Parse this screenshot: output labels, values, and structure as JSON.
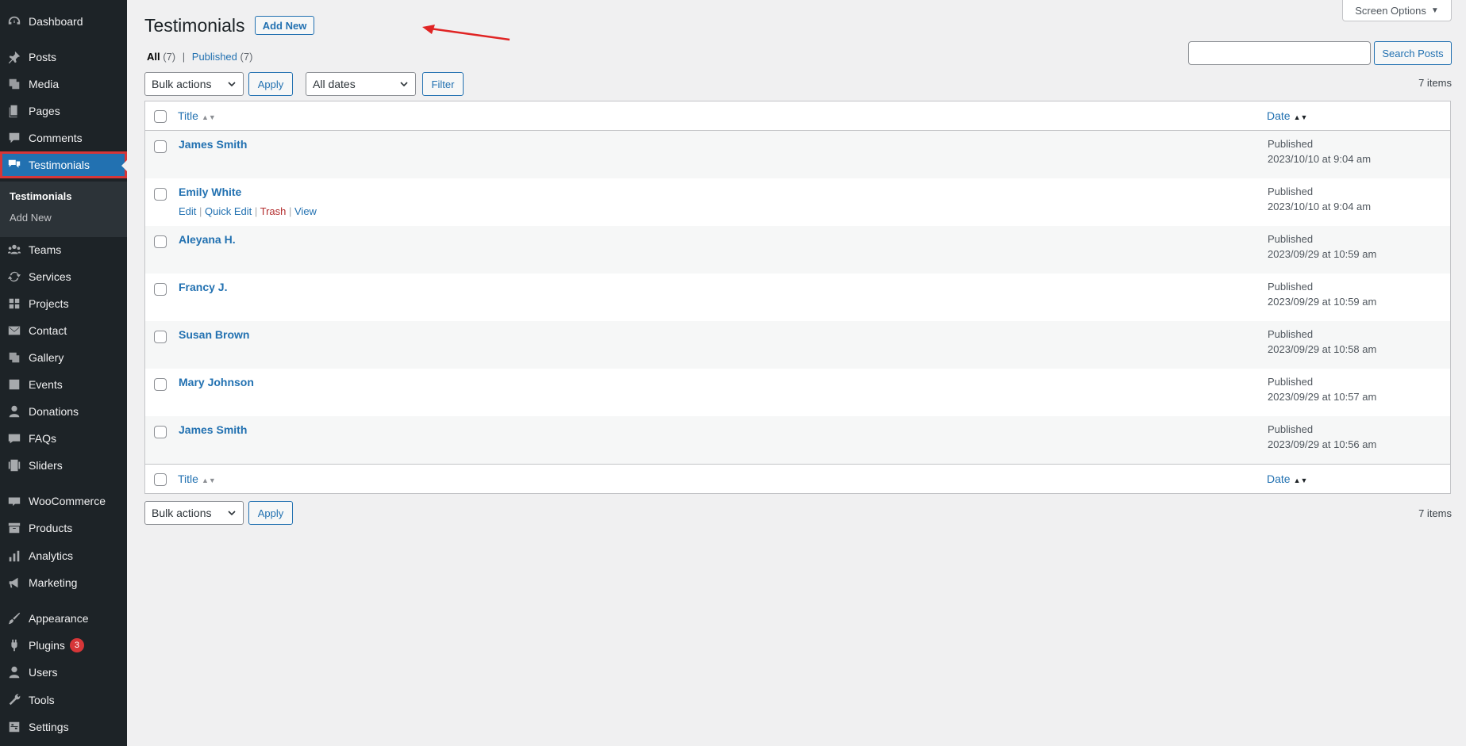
{
  "sidebar": {
    "items": [
      {
        "label": "Dashboard",
        "icon": "dashboard-icon"
      },
      {
        "label": "Posts",
        "icon": "pin-icon"
      },
      {
        "label": "Media",
        "icon": "media-icon"
      },
      {
        "label": "Pages",
        "icon": "pages-icon"
      },
      {
        "label": "Comments",
        "icon": "comment-icon"
      },
      {
        "label": "Testimonials",
        "icon": "testimonial-icon"
      },
      {
        "label": "Teams",
        "icon": "groups-icon"
      },
      {
        "label": "Services",
        "icon": "update-icon"
      },
      {
        "label": "Projects",
        "icon": "grid-icon"
      },
      {
        "label": "Contact",
        "icon": "email-icon"
      },
      {
        "label": "Gallery",
        "icon": "gallery-icon"
      },
      {
        "label": "Events",
        "icon": "calendar-icon"
      },
      {
        "label": "Donations",
        "icon": "person-icon"
      },
      {
        "label": "FAQs",
        "icon": "chat-icon"
      },
      {
        "label": "Sliders",
        "icon": "slides-icon"
      },
      {
        "label": "WooCommerce",
        "icon": "woo-icon"
      },
      {
        "label": "Products",
        "icon": "archive-icon"
      },
      {
        "label": "Analytics",
        "icon": "chart-bar-icon"
      },
      {
        "label": "Marketing",
        "icon": "megaphone-icon"
      },
      {
        "label": "Appearance",
        "icon": "brush-icon"
      },
      {
        "label": "Plugins",
        "icon": "plug-icon",
        "badge": "3"
      },
      {
        "label": "Users",
        "icon": "user-icon"
      },
      {
        "label": "Tools",
        "icon": "wrench-icon"
      },
      {
        "label": "Settings",
        "icon": "settings-icon"
      }
    ],
    "submenu": [
      "Testimonials",
      "Add New"
    ]
  },
  "header": {
    "title": "Testimonials",
    "add_new": "Add New",
    "screen_options": "Screen Options"
  },
  "views": {
    "all_label": "All",
    "all_count": "(7)",
    "sep": "|",
    "published_label": "Published",
    "published_count": "(7)"
  },
  "search": {
    "button": "Search Posts",
    "value": ""
  },
  "toolbar": {
    "bulk_actions": "Bulk actions",
    "apply": "Apply",
    "all_dates": "All dates",
    "filter": "Filter",
    "items_count": "7 items"
  },
  "table": {
    "col_title": "Title",
    "col_date": "Date",
    "row_actions": {
      "edit": "Edit",
      "quick_edit": "Quick Edit",
      "trash": "Trash",
      "view": "View"
    },
    "rows": [
      {
        "name": "James Smith",
        "status": "Published",
        "date": "2023/10/10 at 9:04 am"
      },
      {
        "name": "Emily White",
        "status": "Published",
        "date": "2023/10/10 at 9:04 am"
      },
      {
        "name": "Aleyana H.",
        "status": "Published",
        "date": "2023/09/29 at 10:59 am"
      },
      {
        "name": "Francy J.",
        "status": "Published",
        "date": "2023/09/29 at 10:59 am"
      },
      {
        "name": "Susan Brown",
        "status": "Published",
        "date": "2023/09/29 at 10:58 am"
      },
      {
        "name": "Mary Johnson",
        "status": "Published",
        "date": "2023/09/29 at 10:57 am"
      },
      {
        "name": "James Smith",
        "status": "Published",
        "date": "2023/09/29 at 10:56 am"
      }
    ]
  },
  "colors": {
    "sidebar_bg": "#1d2327",
    "accent": "#2271b1",
    "highlight_border": "#d63638",
    "annotation_arrow": "#e02424"
  }
}
